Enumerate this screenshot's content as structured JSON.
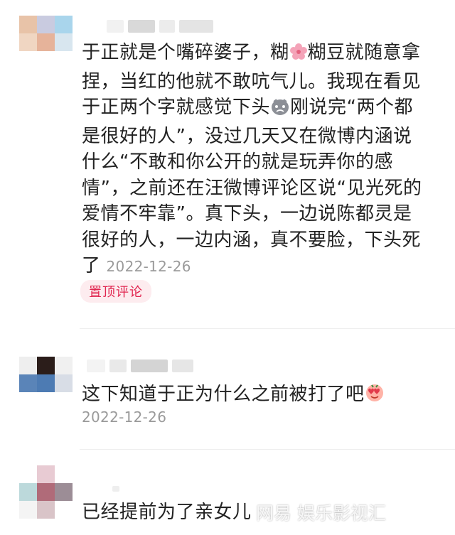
{
  "comments": [
    {
      "text_before_emoji1": "于正就是个嘴碎婆子，糊",
      "text_after_emoji1": "糊豆就随意拿捏，当红的他就不敢吭气儿。我现在看见于正两个字就感觉下头",
      "text_after_emoji2": "刚说完“两个都是很好的人”，没过几天又在微博内涵说什么“不敢和你公开的就是玩弄你的感情”，之前还在汪微博评论区说“见光死的爱情不牢靠”。真下头，一边说陈都灵是很好的人，一边内涵，真不要脸，下头死了",
      "timestamp": "2022-12-26",
      "badge": "置顶评论",
      "emoji1": "sakura-flower-emoji",
      "emoji2": "sad-face-emoji"
    },
    {
      "text": "这下知道于正为什么之前被打了吧",
      "timestamp": "2022-12-26",
      "emoji": "love-eyes-emoji"
    },
    {
      "text": "已经提前为了亲女儿"
    }
  ],
  "watermark": "网易  娱乐影视汇",
  "colors": {
    "badge_text": "#e1254f",
    "badge_bg": "#fdecef",
    "timestamp": "#9a9a9a",
    "body_text": "#222222"
  }
}
